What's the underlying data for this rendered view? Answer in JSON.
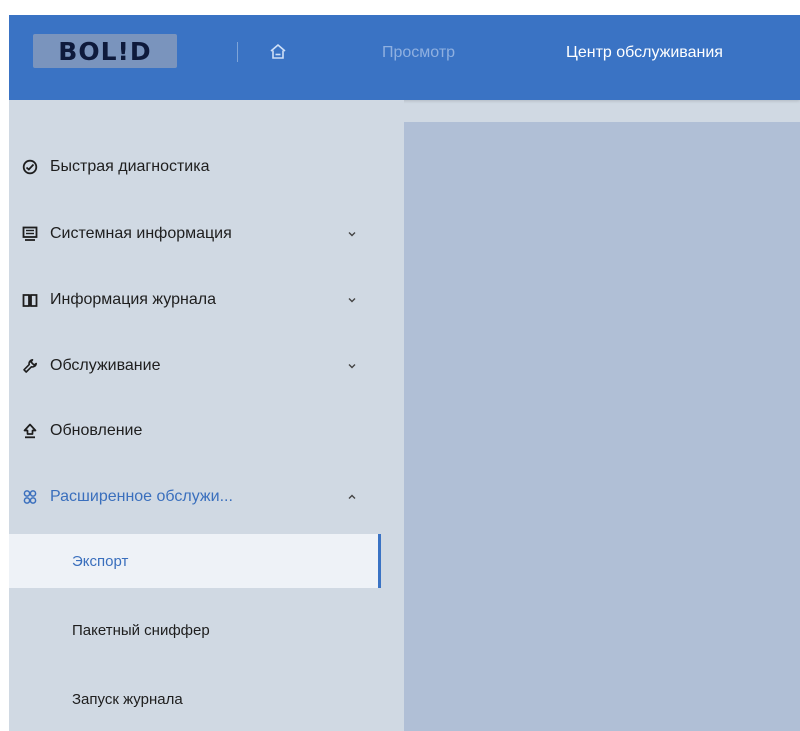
{
  "header": {
    "logo_text": "BOL!D",
    "nav": [
      {
        "label": "Просмотр"
      },
      {
        "label": "Центр обслуживания"
      }
    ]
  },
  "sidebar": {
    "items": [
      {
        "label": "Быстрая диагностика",
        "icon": "diagnostics-icon"
      },
      {
        "label": "Системная информация",
        "icon": "monitor-icon"
      },
      {
        "label": "Информация журнала",
        "icon": "book-icon"
      },
      {
        "label": "Обслуживание",
        "icon": "wrench-icon"
      },
      {
        "label": "Обновление",
        "icon": "upload-icon"
      },
      {
        "label": "Расширенное обслужи...",
        "icon": "advanced-maintenance-icon"
      }
    ],
    "subitems": [
      {
        "label": "Экспорт"
      },
      {
        "label": "Пакетный сниффер"
      },
      {
        "label": "Запуск журнала"
      }
    ]
  },
  "colors": {
    "topbar": "#3a73c4",
    "sidebar_bg": "#d0d9e3",
    "content_bg": "#b0bfd6",
    "accent": "#3a6fbd",
    "selected_bg": "#eef2f7"
  }
}
